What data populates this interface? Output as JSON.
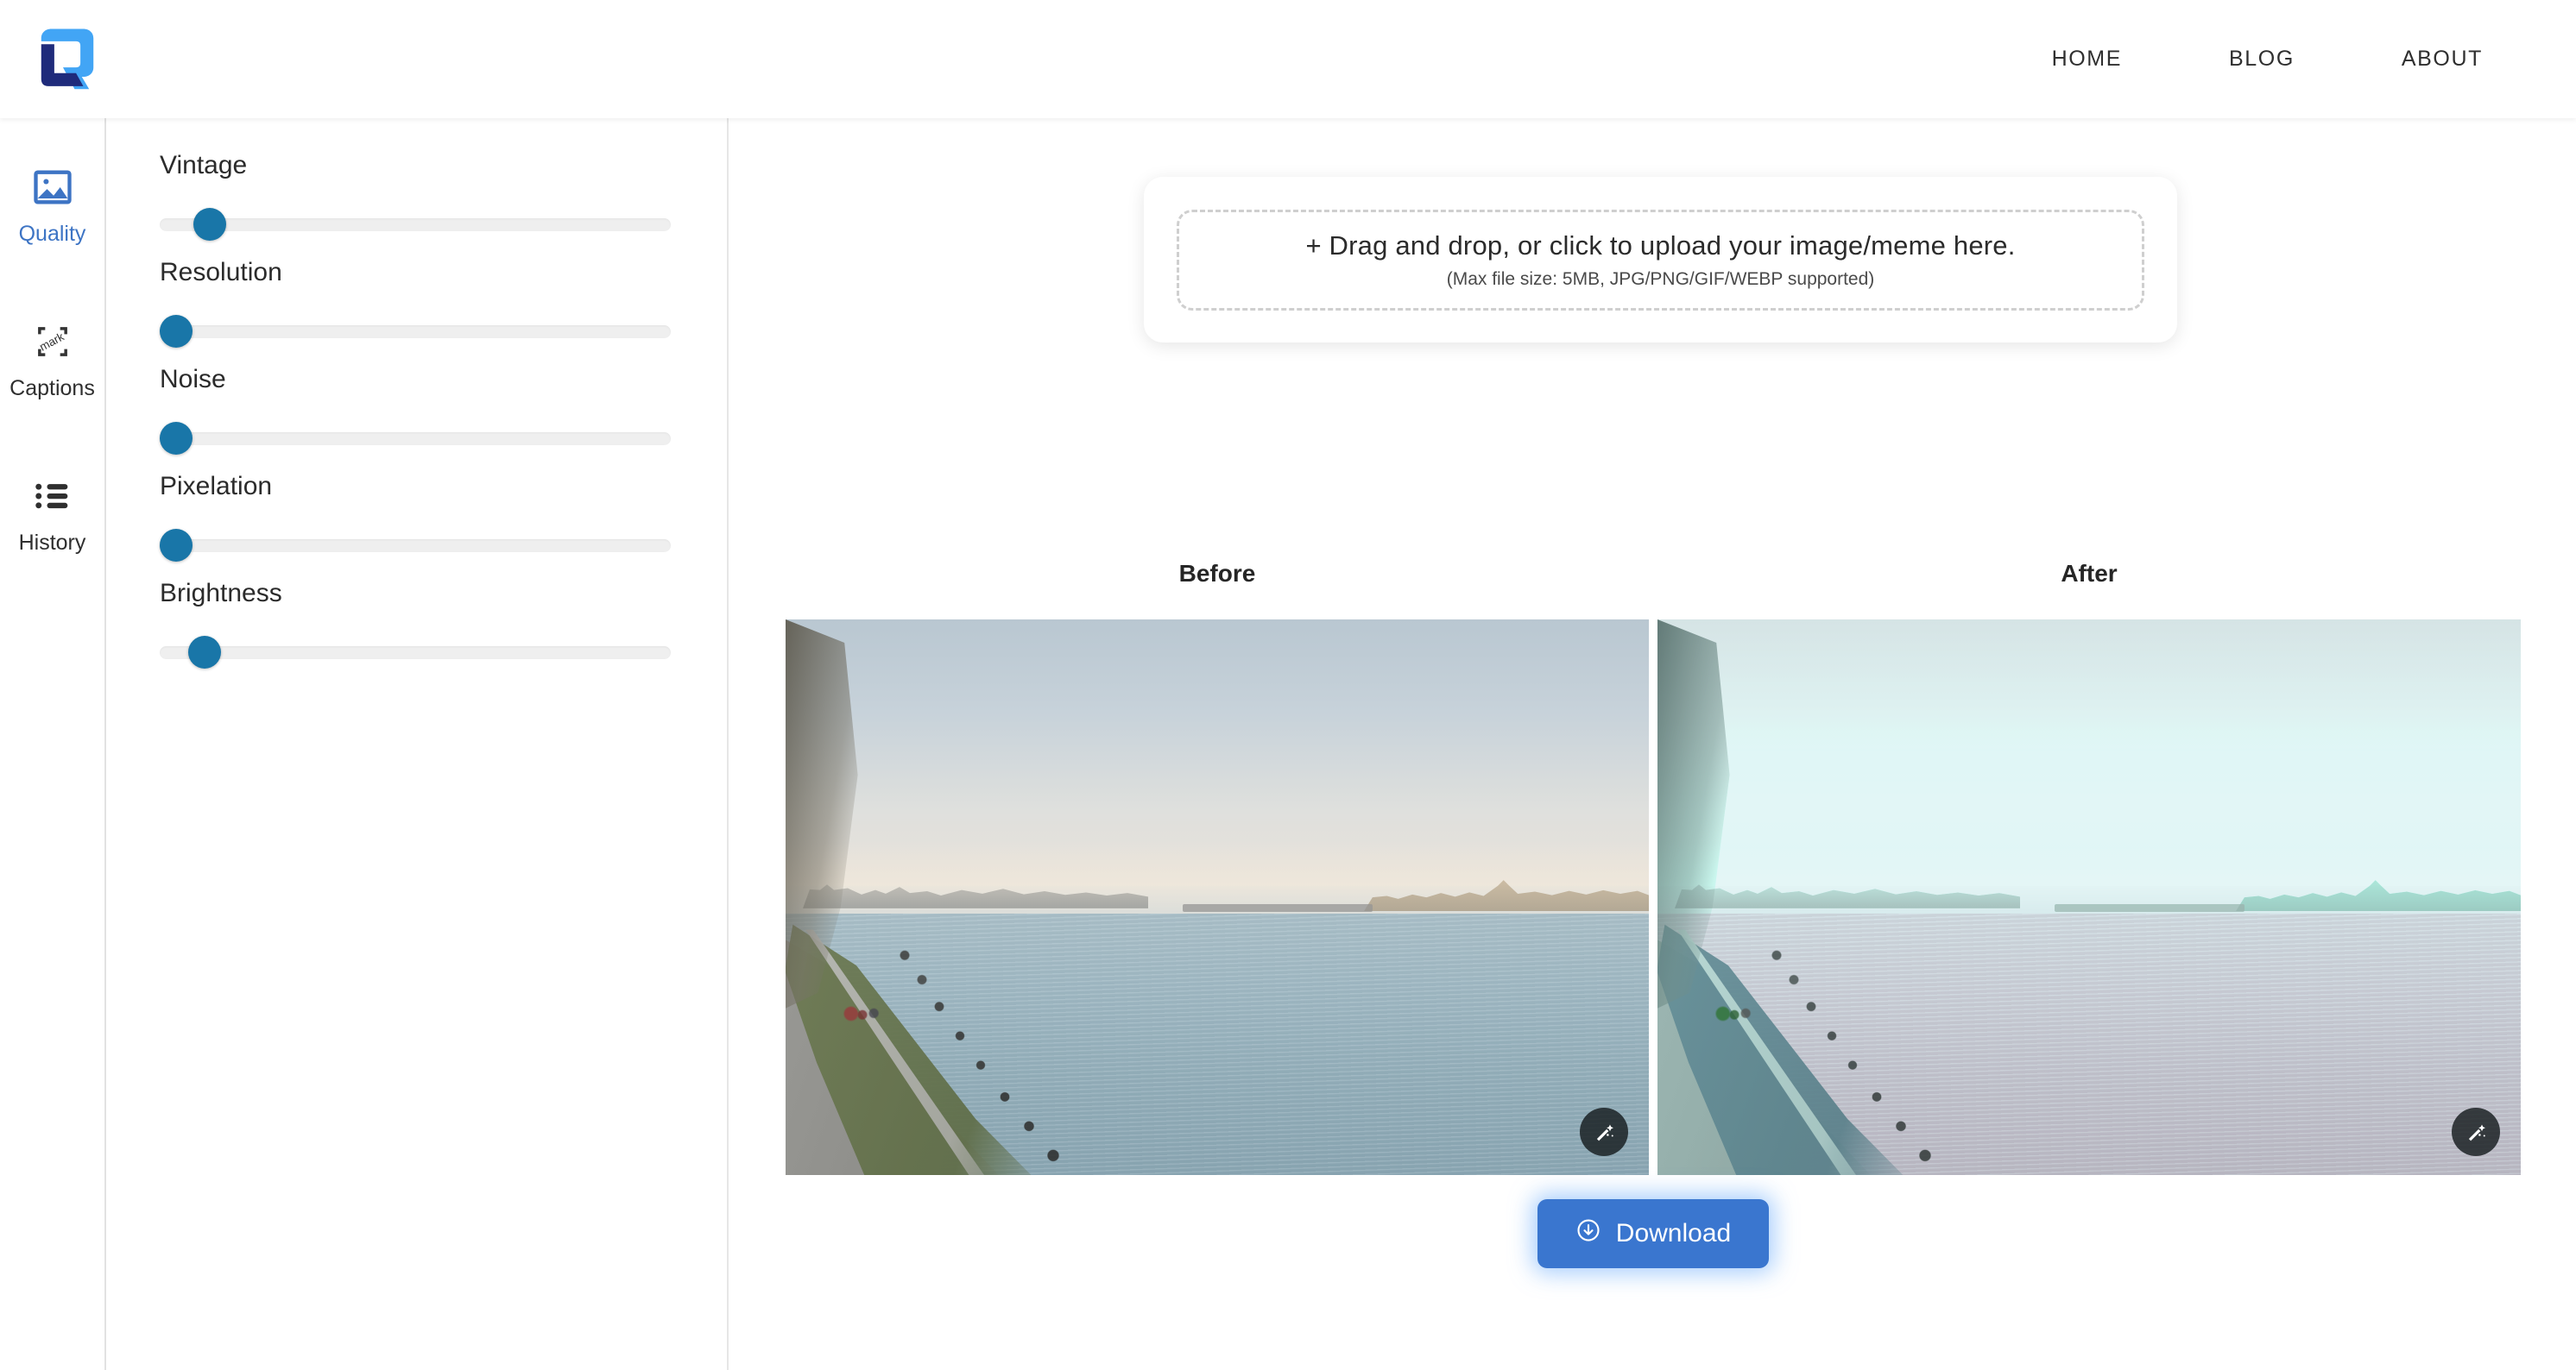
{
  "header": {
    "logo_alt": "app-logo",
    "nav": [
      {
        "label": "HOME"
      },
      {
        "label": "BLOG"
      },
      {
        "label": "ABOUT"
      }
    ]
  },
  "sidebar": {
    "items": [
      {
        "label": "Quality",
        "icon": "image-icon",
        "active": true
      },
      {
        "label": "Captions",
        "icon": "watermark-icon",
        "active": false
      },
      {
        "label": "History",
        "icon": "list-icon",
        "active": false
      }
    ]
  },
  "controls": {
    "sliders": [
      {
        "label": "Vintage",
        "value": 7,
        "min": 0,
        "max": 100
      },
      {
        "label": "Resolution",
        "value": 0,
        "min": 0,
        "max": 100
      },
      {
        "label": "Noise",
        "value": 0,
        "min": 0,
        "max": 100
      },
      {
        "label": "Pixelation",
        "value": 0,
        "min": 0,
        "max": 100
      },
      {
        "label": "Brightness",
        "value": 6,
        "min": 0,
        "max": 100
      }
    ]
  },
  "upload": {
    "primary_text": "+ Drag and drop, or click to upload your image/meme here.",
    "secondary_text": "(Max file size: 5MB, JPG/PNG/GIF/WEBP supported)"
  },
  "compare": {
    "before_label": "Before",
    "after_label": "After",
    "badge_icon": "magic-wand-icon"
  },
  "actions": {
    "download_label": "Download",
    "download_icon": "download-circle-icon"
  },
  "colors": {
    "accent_blue": "#3a76cf",
    "active_blue": "#3d74c4",
    "slider_blue": "#1976a8",
    "logo_light": "#42a5f5",
    "logo_dark": "#1f2b7b",
    "text_dark": "#2b2b2b"
  }
}
